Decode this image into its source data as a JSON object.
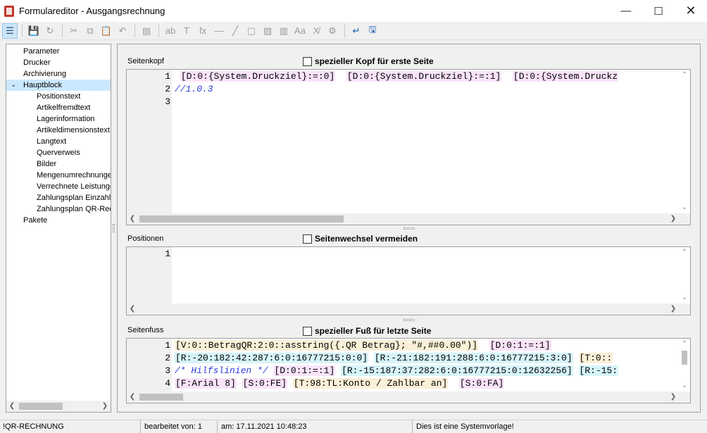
{
  "window": {
    "title": "Formulareditor - Ausgangsrechnung",
    "minimize_glyph": "—",
    "maximize_glyph": "☐",
    "close_glyph": "✕"
  },
  "toolbar": {
    "buttons": [
      {
        "name": "tree-view-icon",
        "glyph": "☰",
        "state": "active"
      },
      {
        "name": "save-icon",
        "glyph": "💾",
        "state": "disabled"
      },
      {
        "name": "revert-icon",
        "glyph": "↻",
        "state": "disabled"
      },
      {
        "name": "cut-icon",
        "glyph": "✂",
        "state": "disabled"
      },
      {
        "name": "copy-icon",
        "glyph": "⧉",
        "state": "disabled"
      },
      {
        "name": "paste-icon",
        "glyph": "📋",
        "state": "disabled"
      },
      {
        "name": "undo-icon",
        "glyph": "↶",
        "state": "disabled"
      },
      {
        "name": "properties-icon",
        "glyph": "▤",
        "state": "disabled"
      },
      {
        "name": "label-field-icon",
        "glyph": "ab",
        "state": "disabled"
      },
      {
        "name": "text-icon",
        "glyph": "T",
        "state": "disabled"
      },
      {
        "name": "formula-icon",
        "glyph": "fx",
        "state": "disabled"
      },
      {
        "name": "horizontal-line-icon",
        "glyph": "—",
        "state": "disabled"
      },
      {
        "name": "diagonal-line-icon",
        "glyph": "╱",
        "state": "disabled"
      },
      {
        "name": "rectangle-icon",
        "glyph": "▢",
        "state": "disabled"
      },
      {
        "name": "image-icon",
        "glyph": "▨",
        "state": "disabled"
      },
      {
        "name": "barcode-icon",
        "glyph": "▥",
        "state": "disabled"
      },
      {
        "name": "font-icon",
        "glyph": "Aa",
        "state": "disabled"
      },
      {
        "name": "clear-format-icon",
        "glyph": "X̸",
        "state": "disabled"
      },
      {
        "name": "user-settings-icon",
        "glyph": "⚙",
        "state": "disabled"
      },
      {
        "name": "wrap-text-icon",
        "glyph": "↵",
        "state": "enabled"
      },
      {
        "name": "save-to-disk-icon",
        "glyph": "🖫",
        "state": "enabled"
      }
    ]
  },
  "tree": {
    "items": [
      {
        "label": "Parameter",
        "level": 0,
        "selected": false
      },
      {
        "label": "Drucker",
        "level": 0,
        "selected": false
      },
      {
        "label": "Archivierung",
        "level": 0,
        "selected": false
      },
      {
        "label": "Hauptblock",
        "level": 0,
        "selected": true,
        "expanded": true
      },
      {
        "label": "Positionstext",
        "level": 1,
        "selected": false
      },
      {
        "label": "Artikelfremdtext",
        "level": 1,
        "selected": false
      },
      {
        "label": "Lagerinformation",
        "level": 1,
        "selected": false
      },
      {
        "label": "Artikeldimensionstext",
        "level": 1,
        "selected": false
      },
      {
        "label": "Langtext",
        "level": 1,
        "selected": false
      },
      {
        "label": "Querverweis",
        "level": 1,
        "selected": false
      },
      {
        "label": "Bilder",
        "level": 1,
        "selected": false
      },
      {
        "label": "Mengenumrechnunge",
        "level": 1,
        "selected": false
      },
      {
        "label": "Verrechnete Leistunge",
        "level": 1,
        "selected": false
      },
      {
        "label": "Zahlungsplan Einzahlu",
        "level": 1,
        "selected": false
      },
      {
        "label": "Zahlungsplan QR-Rec",
        "level": 1,
        "selected": false
      },
      {
        "label": "Pakete",
        "level": 0,
        "selected": false
      }
    ],
    "expander_glyph": "⌄"
  },
  "colors": {
    "tok_pink": "#fae3fa",
    "tok_cyan": "#d6f4fa",
    "tok_yellow": "#fbf0d8",
    "tok_none": "transparent",
    "comment": "#2b3fd6"
  },
  "sections": {
    "header": {
      "label": "Seitenkopf",
      "checkbox": "spezieller Kopf für erste Seite",
      "line_numbers": [
        "1",
        "2",
        "3"
      ],
      "lines": [
        [
          {
            "t": " "
          },
          {
            "t": "[D:0:{System.Druckziel}:=:0]",
            "c": "pink"
          },
          {
            "t": "  "
          },
          {
            "t": "[D:0:{System.Druckziel}:=:1]",
            "c": "pink"
          },
          {
            "t": "  "
          },
          {
            "t": "[D:0:{System.Druckz",
            "c": "pink"
          }
        ],
        [
          {
            "t": "//1.0.3",
            "c": "comment"
          }
        ],
        []
      ]
    },
    "positions": {
      "label": "Positionen",
      "checkbox": "Seitenwechsel vermeiden",
      "line_numbers": [
        "1"
      ],
      "lines": [
        []
      ]
    },
    "footer": {
      "label": "Seitenfuss",
      "checkbox": "spezieller Fuß für letzte Seite",
      "line_numbers": [
        "1",
        "2",
        "3",
        "4"
      ],
      "lines": [
        [
          {
            "t": "[V:0::BetragQR:2:0::asstring({.QR Betrag}; \"#,##0.00\")]",
            "c": "yellow"
          },
          {
            "t": "  "
          },
          {
            "t": "[D:0:1:=:1]",
            "c": "pink"
          }
        ],
        [
          {
            "t": "[R:-20:182:42:287:6:0:16777215:0:0]",
            "c": "cyan"
          },
          {
            "t": " "
          },
          {
            "t": "[R:-21:182:191:288:6:0:16777215:3:0]",
            "c": "cyan"
          },
          {
            "t": " "
          },
          {
            "t": "[T:0::",
            "c": "yellow"
          }
        ],
        [
          {
            "t": "/* Hilfslinien */",
            "c": "comment"
          },
          {
            "t": " "
          },
          {
            "t": "[D:0:1:=:1]",
            "c": "pink"
          },
          {
            "t": " "
          },
          {
            "t": "[R:-15:187:37:282:6:0:16777215:0:12632256]",
            "c": "cyan"
          },
          {
            "t": " "
          },
          {
            "t": "[R:-15:",
            "c": "cyan"
          }
        ],
        [
          {
            "t": "[F:Arial 8]",
            "c": "pink"
          },
          {
            "t": " "
          },
          {
            "t": "[S:0:FE]",
            "c": "pink"
          },
          {
            "t": " "
          },
          {
            "t": "[T:98:TL:Konto / Zahlbar an]",
            "c": "yellow"
          },
          {
            "t": "  "
          },
          {
            "t": "[S:0:FA]",
            "c": "pink"
          }
        ]
      ]
    }
  },
  "status": {
    "form_name": "!QR-RECHNUNG",
    "edited_by": "bearbeitet von:  1",
    "edited_at": "am: 17.11.2021 10:48:23",
    "message": "Dies ist eine Systemvorlage!"
  }
}
